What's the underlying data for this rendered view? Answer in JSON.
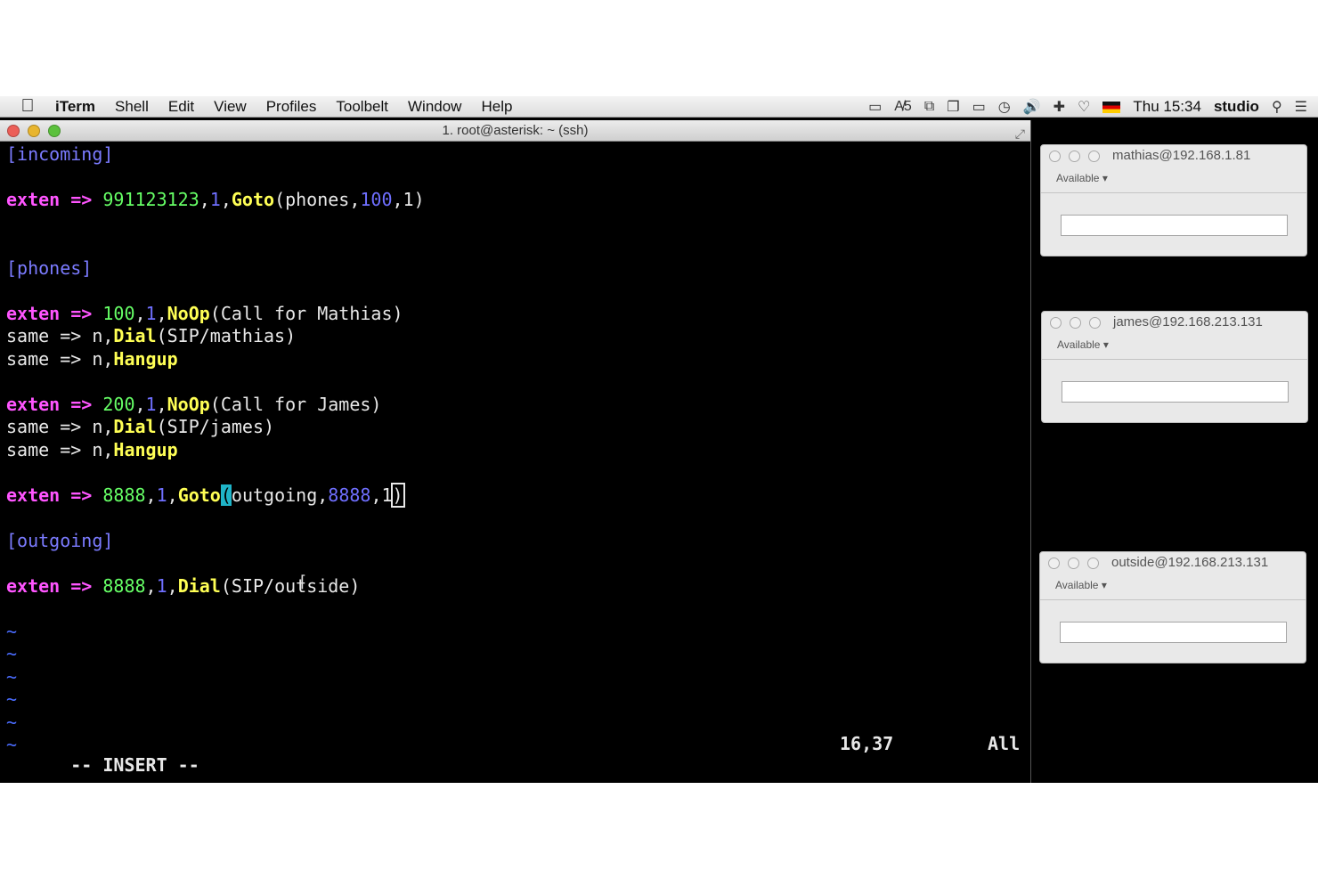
{
  "menubar": {
    "apple": "",
    "items": [
      "iTerm",
      "Shell",
      "Edit",
      "View",
      "Profiles",
      "Toolbelt",
      "Window",
      "Help"
    ],
    "status": {
      "badge_count": "5",
      "clock": "Thu 15:34",
      "user": "studio",
      "icons": [
        "airplay-icon",
        "adobe-icon",
        "window-icon",
        "windows-icon",
        "display-icon",
        "time-machine-icon",
        "volume-icon",
        "bluetooth-icon",
        "wifi-icon",
        "german-flag-icon",
        "search-icon",
        "list-icon"
      ]
    }
  },
  "terminal": {
    "title": "1. root@asterisk: ~ (ssh)",
    "lines": [
      "[incoming]",
      "",
      "exten => 991123123,1,Goto(phones,100,1)",
      "",
      "",
      "[phones]",
      "",
      "exten => 100,1,NoOp(Call for Mathias)",
      "same => n,Dial(SIP/mathias)",
      "same => n,Hangup",
      "",
      "exten => 200,1,NoOp(Call for James)",
      "same => n,Dial(SIP/james)",
      "same => n,Hangup",
      "",
      "exten => 8888,1,Goto(outgoing,8888,1)",
      "",
      "[outgoing]",
      "",
      "exten => 8888,1,Dial(SIP/outside)",
      "",
      "~",
      "~",
      "~",
      "~",
      "~",
      "~"
    ],
    "mode": "-- INSERT --",
    "position": "16,37",
    "scroll": "All"
  },
  "chats": [
    {
      "title": "mathias@192.168.1.81",
      "status": "Available"
    },
    {
      "title": "james@192.168.213.131",
      "status": "Available"
    },
    {
      "title": "outside@192.168.213.131",
      "status": "Available"
    }
  ]
}
